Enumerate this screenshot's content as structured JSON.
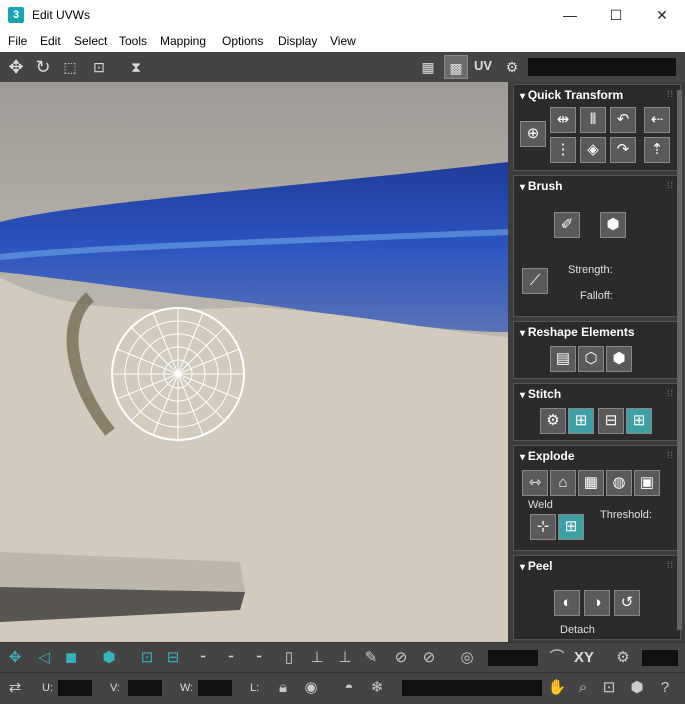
{
  "window": {
    "title": "Edit UVWs",
    "app_icon": "3",
    "controls": {
      "minimize": "—",
      "maximize": "☐",
      "close": "✕"
    }
  },
  "menu": [
    "File",
    "Edit",
    "Select",
    "Tools",
    "Mapping",
    "Options",
    "Display",
    "View"
  ],
  "toolbar": {
    "uv_label": "UV",
    "icons": [
      "move-icon",
      "rotate-icon",
      "scale-icon",
      "freeform-icon",
      "mirror-icon",
      "checker-pattern-icon",
      "checker-map-icon",
      "settings-icon"
    ]
  },
  "panels": {
    "quick_transform": {
      "title": "Quick Transform"
    },
    "brush": {
      "title": "Brush",
      "strength_label": "Strength:",
      "falloff_label": "Falloff:"
    },
    "reshape": {
      "title": "Reshape Elements"
    },
    "stitch": {
      "title": "Stitch"
    },
    "explode": {
      "title": "Explode",
      "weld_label": "Weld",
      "threshold_label": "Threshold:"
    },
    "peel": {
      "title": "Peel",
      "detach_label": "Detach"
    }
  },
  "status": {
    "u_label": "U:",
    "v_label": "V:",
    "w_label": "W:",
    "l_label": "L:",
    "xy_label": "XY"
  },
  "colors": {
    "accent": "#3ea0a6",
    "panel_bg": "#2b2b2b",
    "toolbar_bg": "#444444"
  }
}
